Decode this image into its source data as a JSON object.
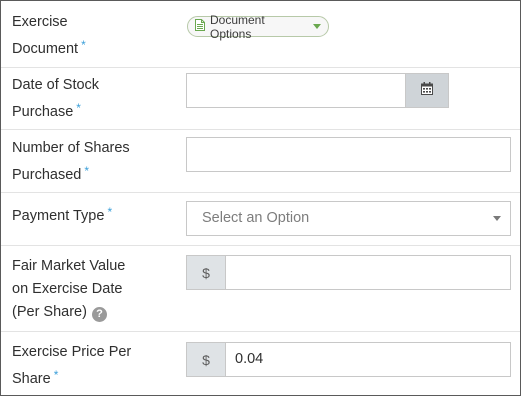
{
  "form": {
    "exercise_document": {
      "label_line1": "Exercise",
      "label_line2": "Document",
      "required_mark": "*",
      "button_label": "Document Options",
      "button_icon": "document-icon",
      "button_caret_color": "#6aa84f"
    },
    "date_of_stock_purchase": {
      "label_line1": "Date of Stock",
      "label_line2": "Purchase",
      "required_mark": "*",
      "value": "",
      "button_icon": "calendar-icon"
    },
    "number_of_shares": {
      "label_line1": "Number of Shares",
      "label_line2": "Purchased",
      "required_mark": "*",
      "value": ""
    },
    "payment_type": {
      "label": "Payment Type",
      "required_mark": "*",
      "placeholder": "Select an Option"
    },
    "fair_market_value": {
      "label_line1": "Fair Market Value",
      "label_line2": "on Exercise Date",
      "label_line3": "(Per Share)",
      "help_icon": "?",
      "prefix": "$",
      "value": ""
    },
    "exercise_price": {
      "label_line1": "Exercise Price Per",
      "label_line2": "Share",
      "required_mark": "*",
      "prefix": "$",
      "value": "0.04"
    }
  },
  "colors": {
    "required": "#3b9fd9",
    "field_border": "#c8c8c8",
    "addon_background": "#dfe3e6",
    "calendar_button_background": "#cfd4d8",
    "document_icon": "#6aa84f"
  }
}
